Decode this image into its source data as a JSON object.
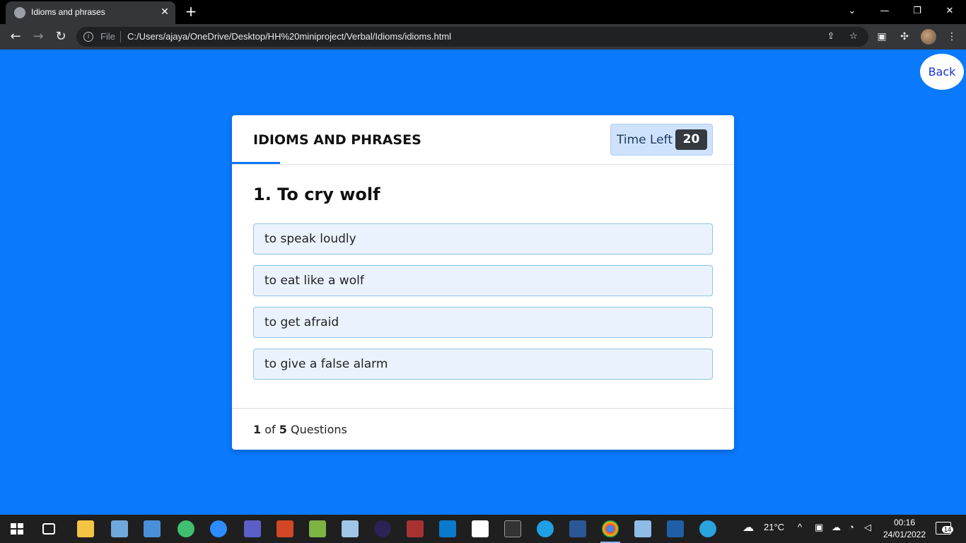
{
  "browser": {
    "tab_title": "Idioms and phrases",
    "tab_close": "✕",
    "new_tab": "+",
    "win_min": "—",
    "win_restore": "❐",
    "win_close": "✕",
    "back": "←",
    "forward": "→",
    "reload": "↻",
    "info": "i",
    "scheme": "File",
    "url": "C:/Users/ajaya/OneDrive/Desktop/HH%20miniproject/Verbal/Idioms/idioms.html",
    "share": "⇪",
    "star": "☆",
    "media": "▣",
    "extensions": "✣",
    "menu": "⋮"
  },
  "page": {
    "back_label": "Back",
    "quiz_title": "IDIOMS AND PHRASES",
    "timer_label": "Time Left",
    "timer_value": "20",
    "question": "1. To cry wolf",
    "options": [
      "to speak loudly",
      "to eat like a wolf",
      "to get afraid",
      "to give a false alarm"
    ],
    "footer_current": "1",
    "footer_of": "of",
    "footer_total": "5",
    "footer_suffix": "Questions"
  },
  "taskbar": {
    "weather": "21°C",
    "time": "00:16",
    "date": "24/01/2022",
    "notifications": "14",
    "tray_chevron": "^"
  },
  "colors": {
    "page_bg": "#0a79fb",
    "timer_bg": "#cfe2fc",
    "option_bg": "#eaf3fd",
    "back_text": "#1a2ed6"
  }
}
